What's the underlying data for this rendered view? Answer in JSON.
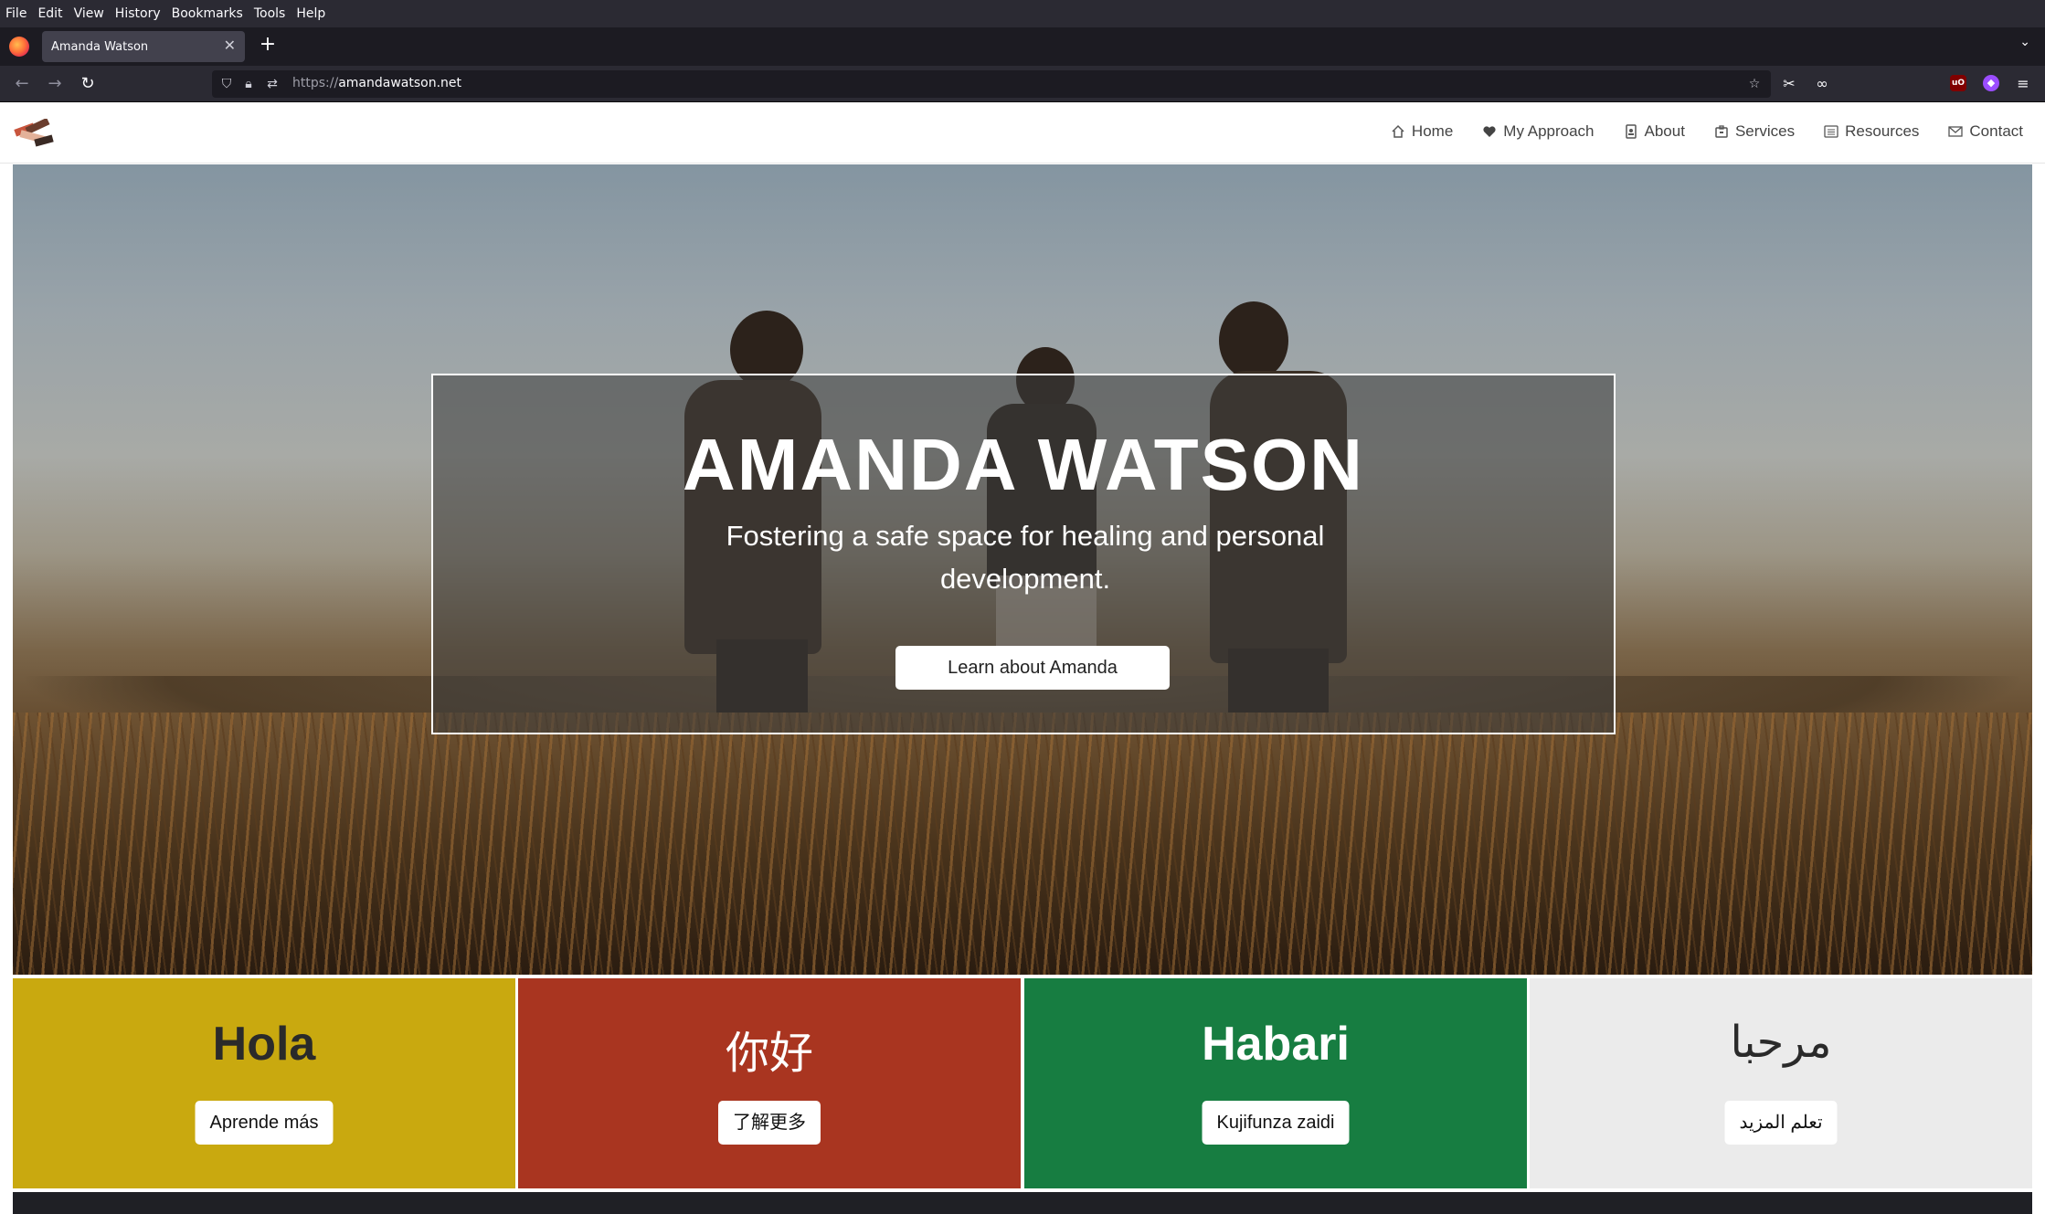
{
  "browser": {
    "menu": [
      "File",
      "Edit",
      "View",
      "History",
      "Bookmarks",
      "Tools",
      "Help"
    ],
    "tab_title": "Amanda Watson",
    "url_protocol": "https://",
    "url_host": "amandawatson.net"
  },
  "site": {
    "nav": [
      {
        "label": "Home",
        "icon": "home-icon"
      },
      {
        "label": "My Approach",
        "icon": "heart-icon"
      },
      {
        "label": "About",
        "icon": "id-badge-icon"
      },
      {
        "label": "Services",
        "icon": "briefcase-icon"
      },
      {
        "label": "Resources",
        "icon": "list-icon"
      },
      {
        "label": "Contact",
        "icon": "envelope-icon"
      }
    ]
  },
  "hero": {
    "title": "AMANDA WATSON",
    "subtitle": "Fostering a safe space for healing and personal development.",
    "button": "Learn about Amanda"
  },
  "tiles": [
    {
      "title": "Hola",
      "button": "Aprende más",
      "bg": "#c9a90f",
      "fg": "#2a2a2a"
    },
    {
      "title": "你好",
      "button": "了解更多",
      "bg": "#a93520",
      "fg": "#ffffff"
    },
    {
      "title": "Habari",
      "button": "Kujifunza zaidi",
      "bg": "#177d41",
      "fg": "#ffffff"
    },
    {
      "title": "مرحبا",
      "button": "تعلم المزيد",
      "bg": "#ebebeb",
      "fg": "#2a2a2a"
    }
  ]
}
